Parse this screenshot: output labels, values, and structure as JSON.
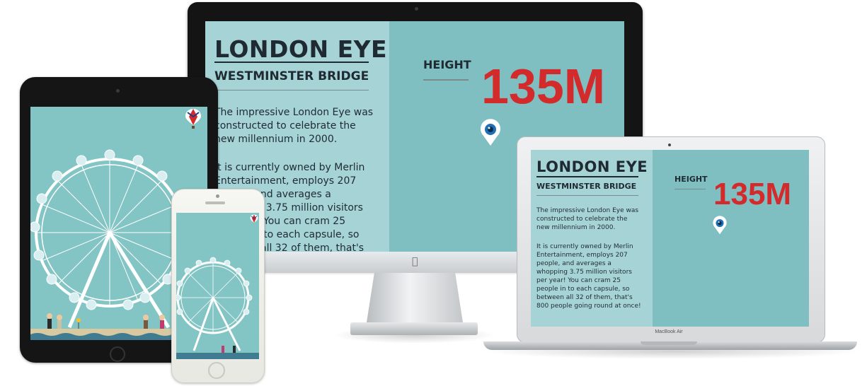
{
  "page": {
    "title": "LONDON EYE",
    "subtitle": "WESTMINSTER BRIDGE",
    "paragraph1": "The impressive London Eye was constructed to celebrate the new millennium in 2000.",
    "paragraph2": "It is currently owned by Merlin Entertainment, employs 207 people, and averages a whopping 3.75 million visitors per year! You can cram 25 people in to each capsule, so between all 32 of them, that's 800 people going round at once!",
    "height_label": "HEIGHT",
    "height_value": "135M"
  },
  "imac": {
    "paragraph1_lines": [
      "The impressive London Eye was",
      "constructed to celebrate the",
      "new millennium in 2000."
    ],
    "paragraph2_lines": [
      "It is currently owned by Merlin",
      "Entertainment, employs 207",
      "people, and averages a",
      "whopping 3.75 million visitors",
      "per year! You can cram 25",
      "people in to each capsule, so",
      "between all 32 of them, that's"
    ]
  },
  "macbook": {
    "label": "MacBook Air",
    "paragraph1_lines": [
      "The impressive London Eye was",
      "constructed to celebrate the",
      "new millennium in 2000."
    ],
    "paragraph2_lines": [
      "It is currently owned by Merlin",
      "Entertainment, employs 207",
      "people, and averages a",
      "whopping 3.75 million visitors",
      "per year! You can cram 25",
      "people in to each capsule, so",
      "between all 32 of them, that's",
      "800 people going round at once!"
    ]
  },
  "icons": {
    "location_pin": "eye-pin-icon",
    "apple_logo": "apple-logo-icon",
    "balloon": "hot-air-balloon-icon",
    "ferris_wheel": "london-eye-wheel-illustration"
  },
  "colors": {
    "teal_light": "#a6d4d6",
    "teal": "#7fbfc2",
    "accent_red": "#d32b2b",
    "heading": "#1f2a33",
    "pin_blue": "#1e6fb6"
  }
}
